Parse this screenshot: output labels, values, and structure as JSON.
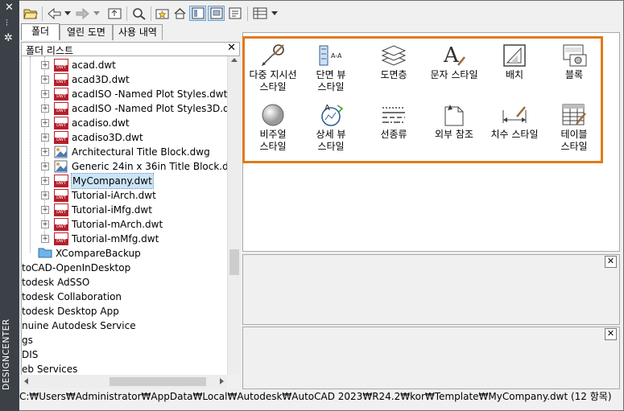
{
  "palette_title": "DESIGNCENTER",
  "tabs": [
    "폴더",
    "열린 도면",
    "사용 내역"
  ],
  "tree_header": "폴더 리스트",
  "tree_items": [
    {
      "label": "acad.dwt",
      "type": "dwt"
    },
    {
      "label": "acad3D.dwt",
      "type": "dwt"
    },
    {
      "label": "acadISO -Named Plot Styles.dwt",
      "type": "dwt"
    },
    {
      "label": "acadISO -Named Plot Styles3D.dwt",
      "type": "dwt"
    },
    {
      "label": "acadiso.dwt",
      "type": "dwt"
    },
    {
      "label": "acadiso3D.dwt",
      "type": "dwt"
    },
    {
      "label": "Architectural Title Block.dwg",
      "type": "dwg"
    },
    {
      "label": "Generic 24in x 36in Title Block.dwg",
      "type": "dwg"
    },
    {
      "label": "MyCompany.dwt",
      "type": "dwt",
      "selected": true
    },
    {
      "label": "Tutorial-iArch.dwt",
      "type": "dwt"
    },
    {
      "label": "Tutorial-iMfg.dwt",
      "type": "dwt"
    },
    {
      "label": "Tutorial-mArch.dwt",
      "type": "dwt"
    },
    {
      "label": "Tutorial-mMfg.dwt",
      "type": "dwt"
    },
    {
      "label": "XCompareBackup",
      "type": "folder"
    },
    {
      "label": "toCAD-OpenInDesktop",
      "type": "plain"
    },
    {
      "label": "todesk AdSSO",
      "type": "plain"
    },
    {
      "label": "todesk Collaboration",
      "type": "plain"
    },
    {
      "label": "todesk Desktop App",
      "type": "plain"
    },
    {
      "label": "nuine Autodesk Service",
      "type": "plain"
    },
    {
      "label": "gs",
      "type": "plain"
    },
    {
      "label": "DIS",
      "type": "plain"
    },
    {
      "label": "eb Services",
      "type": "plain"
    }
  ],
  "content_items": [
    {
      "label": "다중 지시선\n스타일",
      "icon": "multileader-style-icon"
    },
    {
      "label": "단면 뷰\n스타일",
      "icon": "section-view-style-icon"
    },
    {
      "label": "도면층",
      "icon": "layers-icon"
    },
    {
      "label": "문자 스타일",
      "icon": "text-style-icon"
    },
    {
      "label": "배치",
      "icon": "layout-icon"
    },
    {
      "label": "블록",
      "icon": "block-icon"
    },
    {
      "label": "비주얼\n스타일",
      "icon": "visual-style-icon"
    },
    {
      "label": "상세 뷰\n스타일",
      "icon": "detail-view-style-icon"
    },
    {
      "label": "선종류",
      "icon": "linetype-icon"
    },
    {
      "label": "외부 참조",
      "icon": "xref-icon"
    },
    {
      "label": "치수 스타일",
      "icon": "dimension-style-icon"
    },
    {
      "label": "테이블\n스타일",
      "icon": "table-style-icon"
    }
  ],
  "status_path": "C:₩Users₩Administrator₩AppData₩Local₩Autodesk₩AutoCAD 2023₩R24.2₩kor₩Template₩MyCompany.dwt (12 항목)",
  "colors": {
    "highlight_border": "#e07a1a",
    "strip": "#3c4148",
    "dwt_badge": "#b4202a"
  }
}
